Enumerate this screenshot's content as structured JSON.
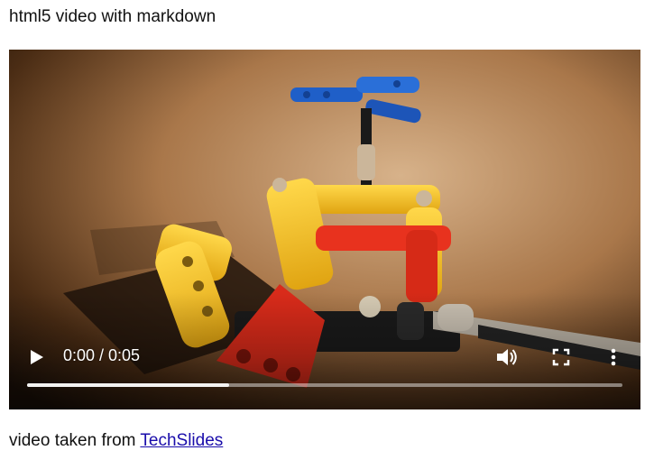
{
  "page": {
    "heading": "html5 video with markdown"
  },
  "video": {
    "time_display": "0:00 / 0:05",
    "buffered_fraction": 0.34,
    "icons": {
      "play": "play-icon",
      "volume": "volume-icon",
      "fullscreen": "fullscreen-icon",
      "more": "more-options-icon"
    }
  },
  "caption": {
    "prefix": "video taken from ",
    "link_text": "TechSlides"
  },
  "colors": {
    "link": "#1a0dab",
    "control": "#ffffff"
  }
}
